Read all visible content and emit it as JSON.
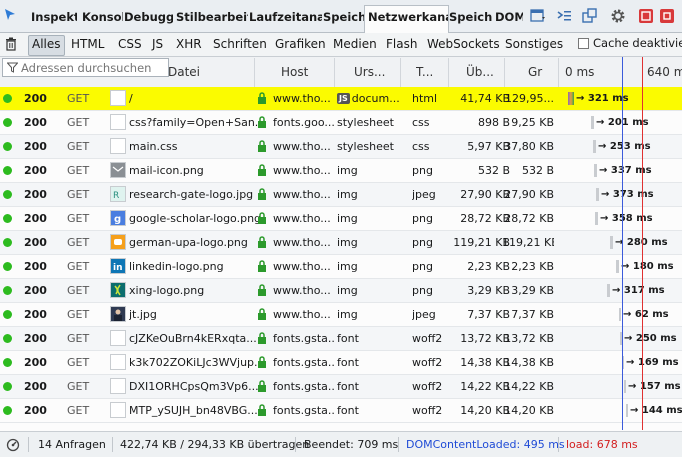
{
  "toolbar": {
    "tabs": [
      {
        "label": "Inspekt"
      },
      {
        "label": "Konsol"
      },
      {
        "label": "Debugg"
      },
      {
        "label": "Stilbearbeit"
      },
      {
        "label": "Laufzeitanal"
      },
      {
        "label": "Speich"
      },
      {
        "label": "Netzwerkana"
      },
      {
        "label": "Speich"
      },
      {
        "label": "DOM"
      }
    ]
  },
  "filters": {
    "types": [
      "Alles",
      "HTML",
      "CSS",
      "JS",
      "XHR",
      "Schriften",
      "Grafiken",
      "Medien",
      "Flash",
      "WebSockets",
      "Sonstiges"
    ],
    "cache_label": "Cache deaktivieren"
  },
  "search": {
    "placeholder": "Adressen durchsuchen"
  },
  "columns": {
    "file": "Datei",
    "host": "Host",
    "cause": "Urs...",
    "type": "T...",
    "transferred": "Üb...",
    "size": "Gr",
    "timeline_start": "0 ms",
    "timeline_mark": "640 ms"
  },
  "requests": [
    {
      "status": "200",
      "method": "GET",
      "file": "/",
      "host": "www.tho...",
      "cause": "docum...",
      "cause_js": true,
      "type": "html",
      "transferred": "41,74 KB",
      "size": "129,95...",
      "time": "→ 321 ms",
      "icon": "blank-icon"
    },
    {
      "status": "200",
      "method": "GET",
      "file": "css?family=Open+San...",
      "host": "fonts.goo...",
      "cause": "stylesheet",
      "cause_js": false,
      "type": "css",
      "transferred": "898 B",
      "size": "9,25 KB",
      "time": "→ 201 ms",
      "icon": "blank-icon"
    },
    {
      "status": "200",
      "method": "GET",
      "file": "main.css",
      "host": "www.tho...",
      "cause": "stylesheet",
      "cause_js": false,
      "type": "css",
      "transferred": "5,97 KB",
      "size": "37,80 KB",
      "time": "→ 253 ms",
      "icon": "blank-icon"
    },
    {
      "status": "200",
      "method": "GET",
      "file": "mail-icon.png",
      "host": "www.tho...",
      "cause": "img",
      "cause_js": false,
      "type": "png",
      "transferred": "532 B",
      "size": "532 B",
      "time": "→ 337 ms",
      "icon": "mail-icon"
    },
    {
      "status": "200",
      "method": "GET",
      "file": "research-gate-logo.jpg",
      "host": "www.tho...",
      "cause": "img",
      "cause_js": false,
      "type": "jpeg",
      "transferred": "27,90 KB",
      "size": "27,90 KB",
      "time": "→ 373 ms",
      "icon": "researchgate-icon"
    },
    {
      "status": "200",
      "method": "GET",
      "file": "google-scholar-logo.png",
      "host": "www.tho...",
      "cause": "img",
      "cause_js": false,
      "type": "png",
      "transferred": "28,72 KB",
      "size": "28,72 KB",
      "time": "→ 358 ms",
      "icon": "google-icon"
    },
    {
      "status": "200",
      "method": "GET",
      "file": "german-upa-logo.png",
      "host": "www.tho...",
      "cause": "img",
      "cause_js": false,
      "type": "png",
      "transferred": "119,21 KB",
      "size": "119,21 KB",
      "time": "→ 280 ms",
      "icon": "upa-icon"
    },
    {
      "status": "200",
      "method": "GET",
      "file": "linkedin-logo.png",
      "host": "www.tho...",
      "cause": "img",
      "cause_js": false,
      "type": "png",
      "transferred": "2,23 KB",
      "size": "2,23 KB",
      "time": "→ 180 ms",
      "icon": "linkedin-icon"
    },
    {
      "status": "200",
      "method": "GET",
      "file": "xing-logo.png",
      "host": "www.tho...",
      "cause": "img",
      "cause_js": false,
      "type": "png",
      "transferred": "3,29 KB",
      "size": "3,29 KB",
      "time": "→ 317 ms",
      "icon": "xing-icon"
    },
    {
      "status": "200",
      "method": "GET",
      "file": "jt.jpg",
      "host": "www.tho...",
      "cause": "img",
      "cause_js": false,
      "type": "jpeg",
      "transferred": "7,37 KB",
      "size": "7,37 KB",
      "time": "→ 62 ms",
      "icon": "photo-icon"
    },
    {
      "status": "200",
      "method": "GET",
      "file": "cJZKeOuBrn4kERxqta...",
      "host": "fonts.gsta...",
      "cause": "font",
      "cause_js": false,
      "type": "woff2",
      "transferred": "13,72 KB",
      "size": "13,72 KB",
      "time": "→ 250 ms",
      "icon": "blank-icon"
    },
    {
      "status": "200",
      "method": "GET",
      "file": "k3k702ZOKiLJc3WVjup...",
      "host": "fonts.gsta...",
      "cause": "font",
      "cause_js": false,
      "type": "woff2",
      "transferred": "14,38 KB",
      "size": "14,38 KB",
      "time": "→ 169 ms",
      "icon": "blank-icon"
    },
    {
      "status": "200",
      "method": "GET",
      "file": "DXI1ORHCpsQm3Vp6...",
      "host": "fonts.gsta...",
      "cause": "font",
      "cause_js": false,
      "type": "woff2",
      "transferred": "14,22 KB",
      "size": "14,22 KB",
      "time": "→ 157 ms",
      "icon": "blank-icon"
    },
    {
      "status": "200",
      "method": "GET",
      "file": "MTP_ySUJH_bn48VBG...",
      "host": "fonts.gsta...",
      "cause": "font",
      "cause_js": false,
      "type": "woff2",
      "transferred": "14,20 KB",
      "size": "14,20 KB",
      "time": "→ 144 ms",
      "icon": "blank-icon"
    }
  ],
  "status": {
    "requests": "14 Anfragen",
    "transferred": "422,74 KB / 294,33 KB übertragen",
    "finished": "Beendet: 709 ms",
    "dom_content_loaded": "DOMContentLoaded: 495 ms",
    "load": "load: 678 ms"
  },
  "colors": {
    "selected_row": "#fbfb00",
    "status_ok": "#2dbb1f",
    "dom_loaded": "#1f4bd6",
    "load": "#d31f1f"
  }
}
